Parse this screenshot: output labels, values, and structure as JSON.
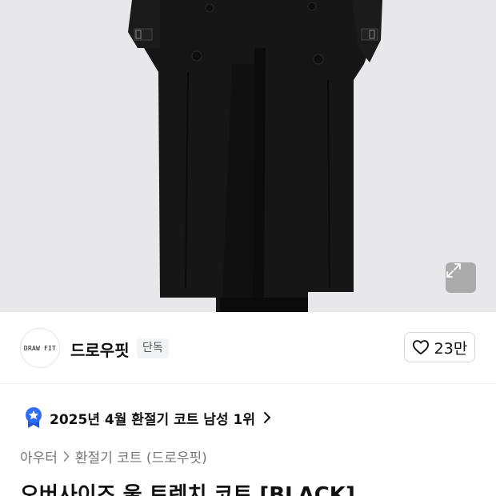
{
  "hero": {
    "expand_icon": "expand-icon",
    "background_color": "#e7e7e9",
    "garment_color": "#141414"
  },
  "brand": {
    "logo_text": "DRAW FIT",
    "name": "드로우핏",
    "badge": "단독",
    "like_icon": "heart-outline-icon",
    "like_count": "23만"
  },
  "ranking": {
    "icon": "star-ribbon-icon",
    "icon_color": "#2f6df6",
    "text": "2025년 4월 환절기 코트 남성 1위",
    "chevron_icon": "chevron-right-icon"
  },
  "breadcrumb": {
    "items": [
      "아우터",
      "환절기 코트 (드로우핏)"
    ]
  },
  "product": {
    "title": "오버사이즈 울 트렌치 코트 [BLACK]"
  }
}
